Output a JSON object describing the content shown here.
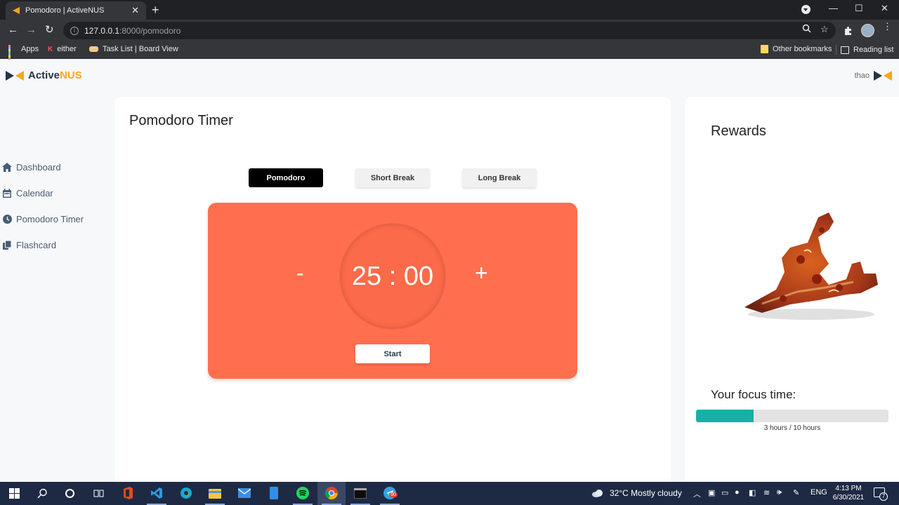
{
  "browser": {
    "tab_title": "Pomodoro | ActiveNUS",
    "tab_close": "✕",
    "new_tab": "+",
    "url_host": "127.0.0.1",
    "url_path": ":8000/pomodoro",
    "bookmarks": [
      {
        "label": "Apps"
      },
      {
        "label": "either"
      },
      {
        "label": "Task List | Board View"
      }
    ],
    "other_bookmarks": "Other bookmarks",
    "reading_list": "Reading list"
  },
  "app": {
    "brand_main": "Active",
    "brand_highlight": "NUS",
    "username": "thao",
    "accent_color": "#f6a71b",
    "brand_dark": "#243447"
  },
  "sidebar": {
    "items": [
      {
        "label": "Dashboard",
        "icon": "home-icon"
      },
      {
        "label": "Calendar",
        "icon": "calendar-icon"
      },
      {
        "label": "Pomodoro Timer",
        "icon": "clock-icon"
      },
      {
        "label": "Flashcard",
        "icon": "copy-icon"
      }
    ]
  },
  "main": {
    "title": "Pomodoro Timer",
    "modes": [
      {
        "label": "Pomodoro",
        "active": true
      },
      {
        "label": "Short Break",
        "active": false
      },
      {
        "label": "Long Break",
        "active": false
      }
    ],
    "decrement_label": "-",
    "increment_label": "+",
    "timer_display": "25 : 00",
    "start_label": "Start",
    "panel_color": "#ff6f4e"
  },
  "rewards": {
    "title": "Rewards",
    "focus_title": "Your focus time:",
    "focus_label": "3 hours / 10 hours",
    "focus_fraction": 0.3,
    "progress_color": "#17b0a6"
  },
  "taskbar": {
    "weather": "32°C  Mostly cloudy",
    "lang": "ENG",
    "time": "4:13 PM",
    "date": "6/30/2021",
    "notification_count": "7",
    "spotify_badge": "90"
  }
}
